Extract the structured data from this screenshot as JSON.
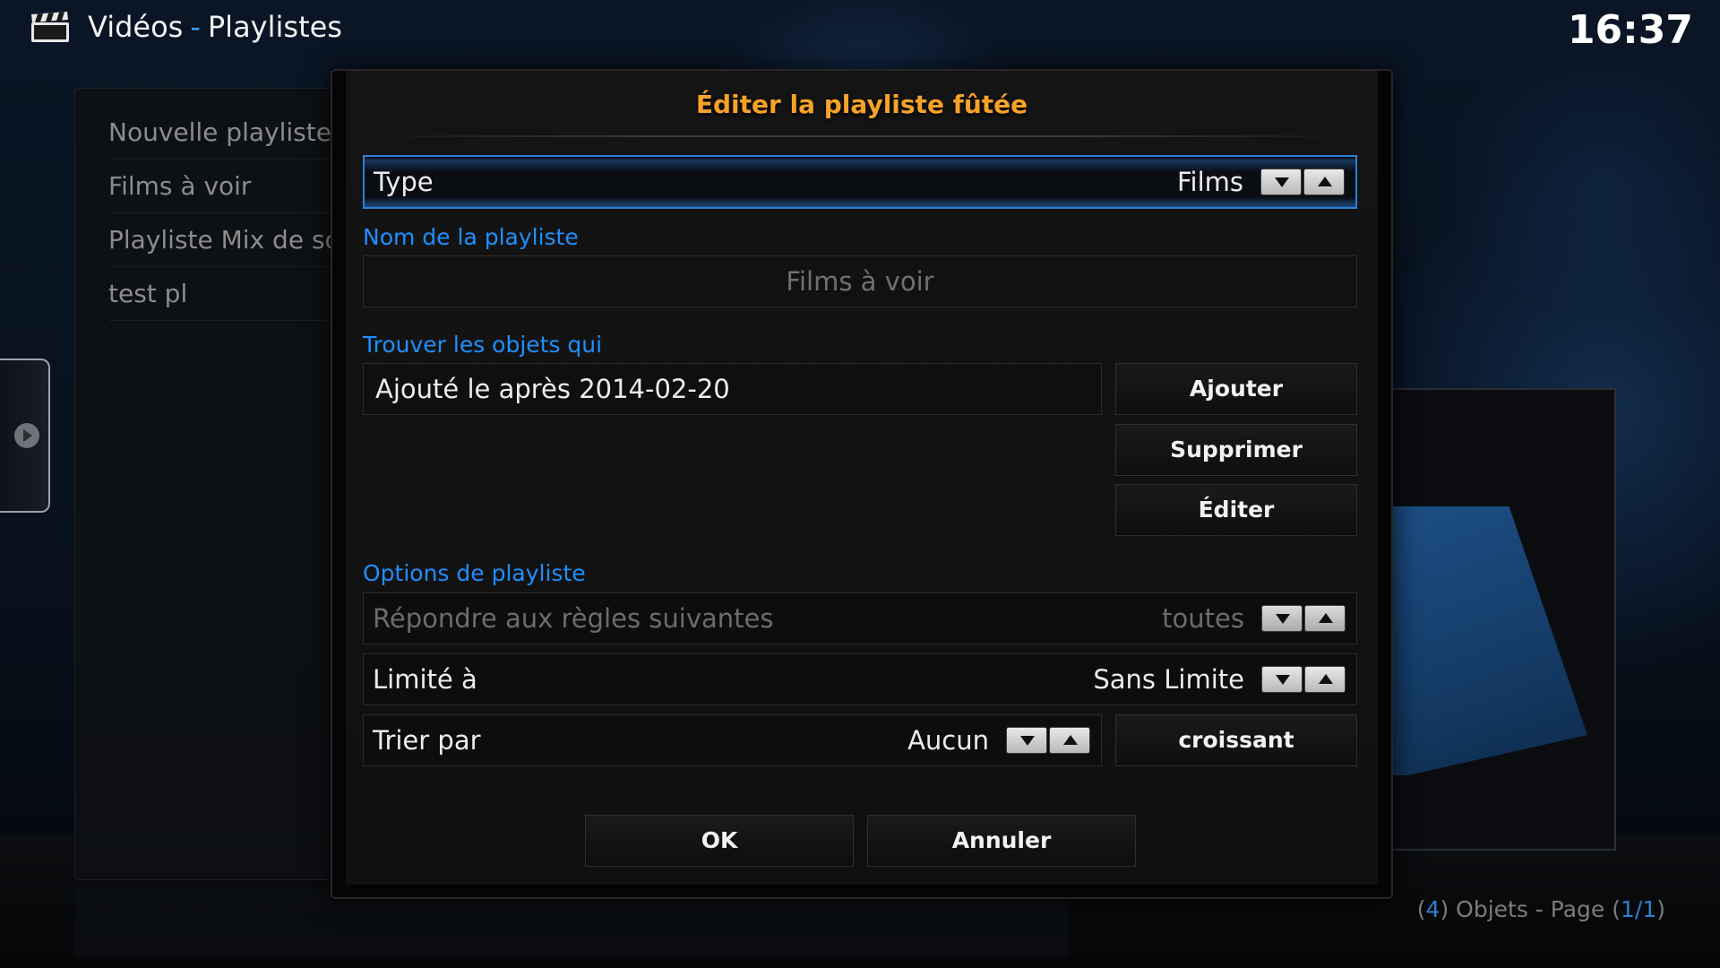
{
  "header": {
    "section": "Vidéos",
    "separator": "-",
    "page": "Playlistes",
    "clock": "16:37",
    "icon": "clapperboard-icon"
  },
  "sidebar": {
    "items": [
      {
        "label": "Nouvelle playliste"
      },
      {
        "label": "Films à voir"
      },
      {
        "label": "Playliste Mix de so"
      },
      {
        "label": "test pl"
      }
    ]
  },
  "pager": {
    "count": "4",
    "objects_label": "Objets - Page",
    "page": "1/1"
  },
  "dialog": {
    "title": "Éditer la playliste fûtée",
    "type_row": {
      "label": "Type",
      "value": "Films"
    },
    "name_section": "Nom de la playliste",
    "name_value": "Films à voir",
    "rules_section": "Trouver les objets qui",
    "rules": [
      {
        "text": "Ajouté le après 2014-02-20"
      }
    ],
    "rule_buttons": {
      "add": "Ajouter",
      "remove": "Supprimer",
      "edit": "Éditer"
    },
    "options_section": "Options de playliste",
    "match_row": {
      "label": "Répondre aux règles suivantes",
      "value": "toutes"
    },
    "limit_row": {
      "label": "Limité à",
      "value": "Sans Limite"
    },
    "sort_row": {
      "label": "Trier par",
      "value": "Aucun"
    },
    "order_button": "croissant",
    "ok": "OK",
    "cancel": "Annuler"
  },
  "colors": {
    "accent_blue": "#1e8fff",
    "title_orange": "#f6a229",
    "focus_border": "#2f7fd6"
  }
}
